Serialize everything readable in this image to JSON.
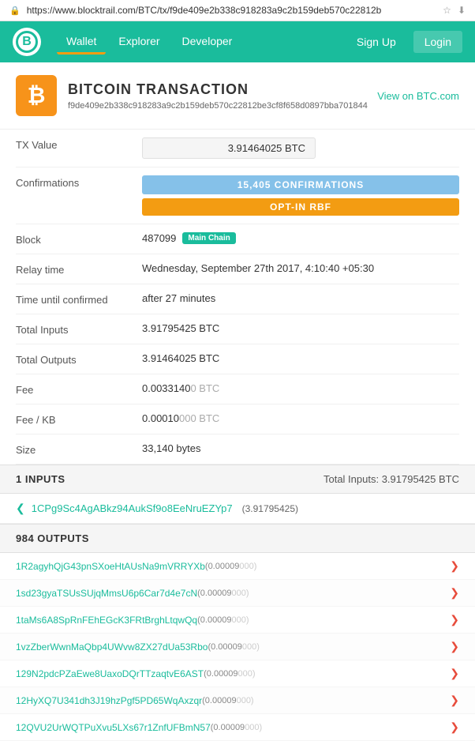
{
  "url": {
    "text": "https://www.blocktrail.com/BTC/tx/f9de409e2b338c918283a9c2b159deb570c22812b",
    "secure": true
  },
  "nav": {
    "logo": "B",
    "links": [
      {
        "label": "Wallet",
        "active": true
      },
      {
        "label": "Explorer",
        "active": false
      },
      {
        "label": "Developer",
        "active": false
      }
    ],
    "right": [
      {
        "label": "Sign Up"
      },
      {
        "label": "Login"
      }
    ]
  },
  "transaction": {
    "title": "BITCOIN TRANSACTION",
    "view_link": "View on BTC.com",
    "hash": "f9de409e2b338c918283a9c2b159deb570c22812be3cf8f658d0897bba701844",
    "fields": {
      "tx_value_label": "TX Value",
      "tx_value": "3.91464025 BTC",
      "confirmations_label": "Confirmations",
      "confirmations": "15,405 CONFIRMATIONS",
      "rbf": "OPT-IN RBF",
      "block_label": "Block",
      "block_num": "487099",
      "block_chain": "Main Chain",
      "relay_label": "Relay time",
      "relay_value": "Wednesday, September 27th 2017, 4:10:40 +05:30",
      "time_label": "Time until confirmed",
      "time_value": "after 27 minutes",
      "inputs_label": "Total Inputs",
      "inputs_value": "3.91795425 BTC",
      "outputs_label": "Total Outputs",
      "outputs_value": "3.91464025 BTC",
      "fee_label": "Fee",
      "fee_main": "0.0033140",
      "fee_dim": "0 BTC",
      "fee_kb_label": "Fee / KB",
      "fee_kb_main": "0.00010",
      "fee_kb_dim": "000 BTC",
      "size_label": "Size",
      "size_value": "33,140 bytes"
    }
  },
  "inputs_section": {
    "title": "1 INPUTS",
    "total": "Total Inputs: 3.91795425 BTC",
    "items": [
      {
        "address": "1CPg9Sc4AgABkz94AukSf9o8EeNruEZYp7",
        "amount": "(3.91795425)"
      }
    ]
  },
  "outputs_section": {
    "title": "984 OUTPUTS",
    "items": [
      {
        "address": "1R2agyhQjG43pnSXoeHtAUsNa9mVRRYXb",
        "amount_main": "(0.00009",
        "amount_dim": "000)"
      },
      {
        "address": "1sd23gyaTSUsSUjqMmsU6p6Car7d4e7cN",
        "amount_main": "(0.00009",
        "amount_dim": "000)"
      },
      {
        "address": "1taMs6A8SpRnFEhEGcK3FRtBrghLtqwQq",
        "amount_main": "(0.00009",
        "amount_dim": "000)"
      },
      {
        "address": "1vzZberWwnMaQbp4UWvw8ZX27dUa53Rbo",
        "amount_main": "(0.00009",
        "amount_dim": "000)"
      },
      {
        "address": "129N2pdcPZaEwe8UaxoDQrTTzaqtvE6AST",
        "amount_main": "(0.00009",
        "amount_dim": "000)"
      },
      {
        "address": "12HyXQ7U341dh3J19hzPgf5PD65WqAxzqr",
        "amount_main": "(0.00009",
        "amount_dim": "000)"
      },
      {
        "address": "12QVU2UrWQTPuXvu5LXs67r1ZnfUFBmN57",
        "amount_main": "(0.00009",
        "amount_dim": "000)"
      }
    ]
  }
}
